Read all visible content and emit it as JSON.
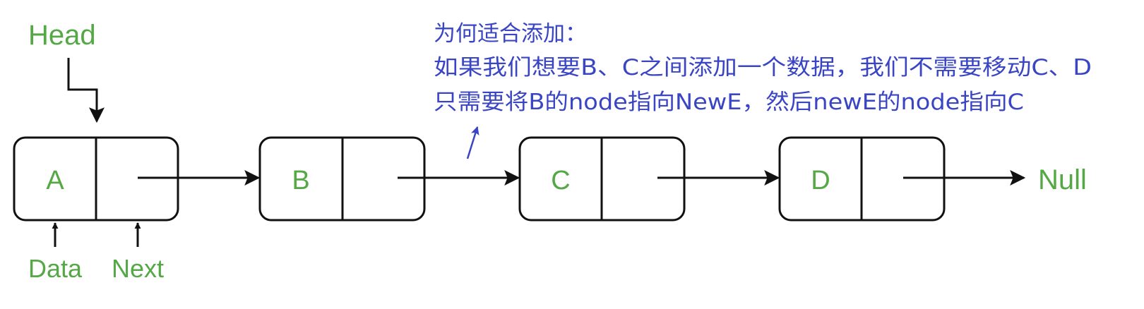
{
  "colors": {
    "label_green": "#54a845",
    "note_blue": "#3a45c4",
    "stroke_black": "#111111",
    "background": "#ffffff"
  },
  "head_label": "Head",
  "nodes": [
    {
      "name": "a",
      "data": "A"
    },
    {
      "name": "b",
      "data": "B"
    },
    {
      "name": "c",
      "data": "C"
    },
    {
      "name": "d",
      "data": "D"
    }
  ],
  "null_label": "Null",
  "pointer_labels": {
    "data": "Data",
    "next": "Next"
  },
  "annotation": {
    "line1": "为何适合添加：",
    "line2": "如果我们想要B、C之间添加一个数据，我们不需要移动C、D",
    "line3": "只需要将B的node指向NewE，然后newE的node指向C"
  }
}
